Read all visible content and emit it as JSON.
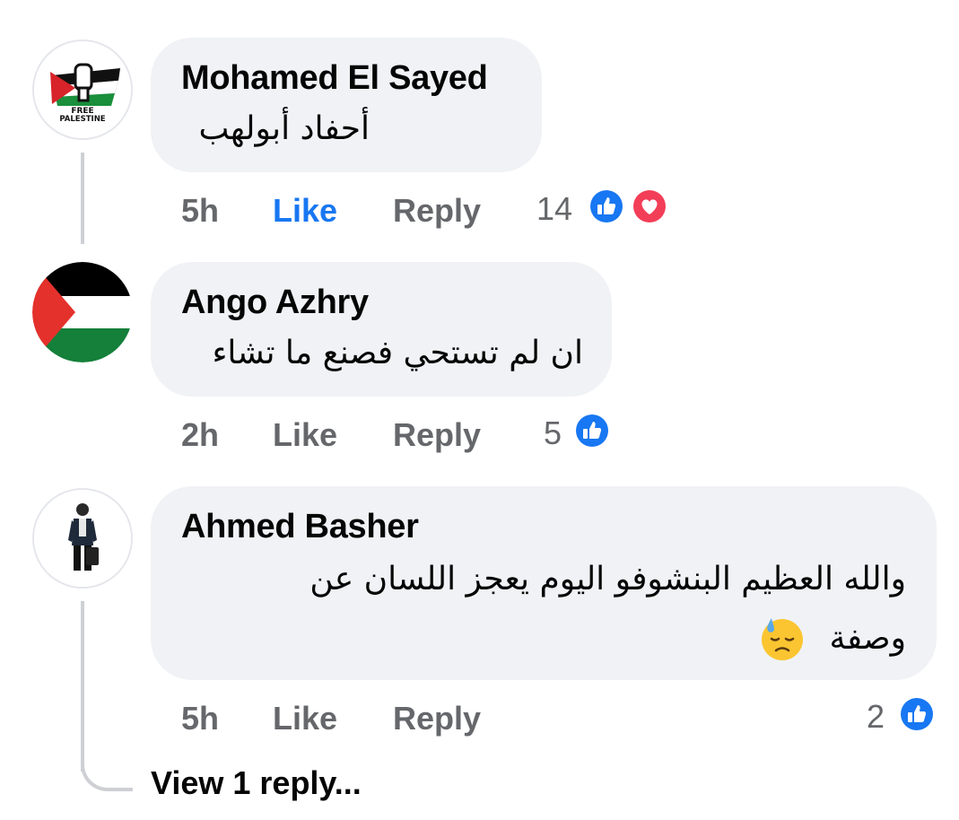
{
  "comments": [
    {
      "author": "Mohamed El Sayed",
      "text": "أحفاد أبولهب",
      "time": "5h",
      "like_label": "Like",
      "reply_label": "Reply",
      "reaction_count": "14",
      "liked_by_viewer": true,
      "avatar_text": [
        "FREE",
        "PALESTINE"
      ]
    },
    {
      "author": "Ango Azhry",
      "text": "ان لم تستحي فصنع ما تشاء",
      "time": "2h",
      "like_label": "Like",
      "reply_label": "Reply",
      "reaction_count": "5",
      "liked_by_viewer": false
    },
    {
      "author": "Ahmed Basher",
      "text_line1": "والله العظيم البنشوفو اليوم يعجز اللسان عن",
      "text_line2": "وصفة",
      "time": "5h",
      "like_label": "Like",
      "reply_label": "Reply",
      "reaction_count": "2",
      "liked_by_viewer": false,
      "view_replies": "View 1 reply..."
    }
  ],
  "colors": {
    "like_blue": "#1877f2",
    "love_red": "#f33e58",
    "muted_text": "#65676b",
    "bubble_bg": "#f0f2f5",
    "thread_line": "#ced0d4"
  },
  "icons": {
    "like": "like-reaction-icon",
    "love": "love-reaction-icon",
    "emoji": "downcast-sweat-face-emoji"
  }
}
